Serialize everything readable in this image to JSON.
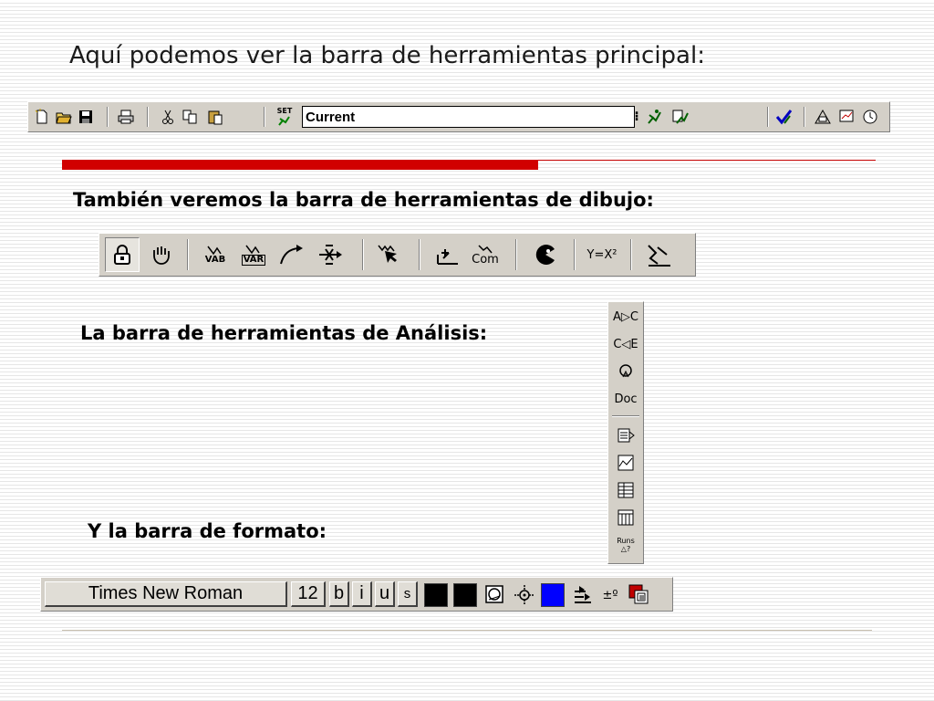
{
  "headings": {
    "main": "Aquí podemos ver la barra de herramientas principal:",
    "drawing": "También veremos la barra de herramientas de dibujo:",
    "analysis": "La barra de herramientas de Análisis:",
    "format": "Y la barra de formato:"
  },
  "main_toolbar": {
    "icons": [
      "new-document-icon",
      "open-folder-icon",
      "save-disk-icon",
      "print-icon",
      "cut-icon",
      "copy-icon",
      "paste-icon",
      "set-runner-icon"
    ],
    "set_label": "SET",
    "current_value": "Current",
    "right_icons": [
      "run-icon",
      "run-all-icon",
      "check-icon",
      "browse-network-icon",
      "graph-icon",
      "clock-icon"
    ]
  },
  "drawing_toolbar": {
    "icons": [
      "lock-icon",
      "hand-icon",
      "var-flow-icon",
      "var-box-icon",
      "connector-arrow-icon",
      "flow-valve-icon",
      "cursor-var-icon",
      "input-output-icon",
      "comment-icon",
      "pie-icon",
      "equation-icon",
      "sketch-icon"
    ],
    "labels": {
      "vab": "VAB",
      "var": "VAR",
      "com": "Com",
      "yx2": "Y=X²"
    }
  },
  "analysis_toolbar": {
    "labels": {
      "abc": "A▷C",
      "cde": "C◁E",
      "doc": "Doc",
      "runs": "Runs"
    },
    "icons": [
      "causes-tree-icon",
      "uses-tree-icon",
      "loops-icon",
      "document-icon",
      "causes-strip-icon",
      "graph-icon",
      "table-icon",
      "table-time-down-icon",
      "runs-compare-icon"
    ]
  },
  "format_toolbar": {
    "font_name": "Times New Roman",
    "font_size": "12",
    "bold": "b",
    "italic": "i",
    "underline": "u",
    "strike": "s",
    "colors": {
      "color1": "#000000",
      "color2": "#000000",
      "color3": "#0000ff"
    }
  }
}
